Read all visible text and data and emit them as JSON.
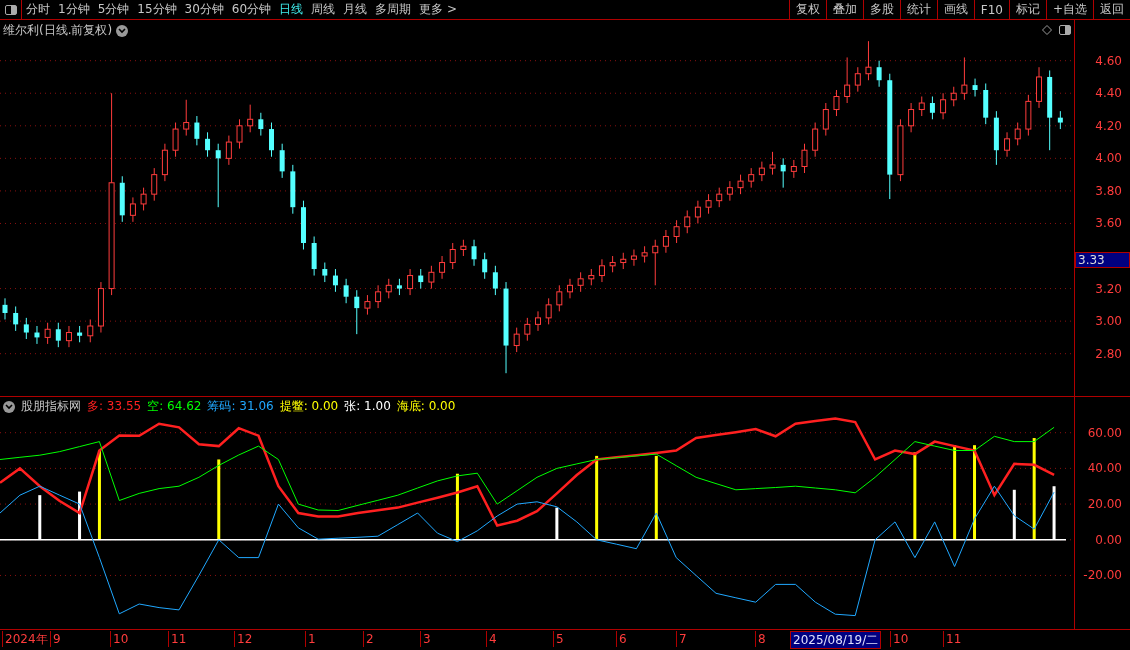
{
  "toolbar": {
    "periods": [
      {
        "label": "分时",
        "selected": false
      },
      {
        "label": "1分钟",
        "selected": false
      },
      {
        "label": "5分钟",
        "selected": false
      },
      {
        "label": "15分钟",
        "selected": false
      },
      {
        "label": "30分钟",
        "selected": false
      },
      {
        "label": "60分钟",
        "selected": false
      },
      {
        "label": "日线",
        "selected": true
      },
      {
        "label": "周线",
        "selected": false
      },
      {
        "label": "月线",
        "selected": false
      },
      {
        "label": "多周期",
        "selected": false
      },
      {
        "label": "更多 >",
        "selected": false
      }
    ],
    "actions": [
      "复权",
      "叠加",
      "多股",
      "统计",
      "画线",
      "F10",
      "标记",
      "+自选",
      "返回"
    ]
  },
  "main_chart": {
    "title": "维尔利(日线.前复权)",
    "current_price": "3.33",
    "chart_data": {
      "type": "candlestick",
      "grid": true,
      "ylim": [
        2.54,
        4.85
      ],
      "yticks": [
        {
          "value": 4.6,
          "label": "4.60"
        },
        {
          "value": 4.4,
          "label": "4.40"
        },
        {
          "value": 4.2,
          "label": "4.20"
        },
        {
          "value": 4.0,
          "label": "4.00"
        },
        {
          "value": 3.8,
          "label": "3.80"
        },
        {
          "value": 3.6,
          "label": "3.60"
        },
        {
          "value": 3.2,
          "label": "3.20"
        },
        {
          "value": 3.0,
          "label": "3.00"
        },
        {
          "value": 2.8,
          "label": "2.80"
        }
      ],
      "categories": [
        null,
        null,
        null,
        null,
        null,
        null,
        null,
        null,
        null,
        null,
        null,
        null,
        null,
        null,
        null,
        null,
        null,
        null,
        null,
        null,
        null,
        null,
        null,
        null,
        null,
        null,
        null,
        null,
        null,
        null,
        null,
        null,
        null,
        null,
        null,
        null,
        null,
        null,
        null,
        null,
        null,
        null,
        null,
        null,
        null,
        null,
        null,
        null,
        null,
        null,
        null,
        null,
        null,
        null,
        null,
        null,
        null,
        null,
        null,
        null,
        null,
        null,
        null,
        null,
        null,
        null,
        null,
        null,
        null,
        null,
        null,
        null,
        null,
        null,
        null,
        null,
        null,
        null,
        null,
        null,
        null,
        null,
        null,
        null,
        null,
        null,
        null,
        null,
        null,
        null,
        null,
        null,
        null,
        null,
        null,
        null,
        null,
        null,
        null,
        null
      ],
      "ohlc": [
        [
          3.1,
          3.14,
          3.01,
          3.05
        ],
        [
          3.05,
          3.09,
          2.94,
          2.98
        ],
        [
          2.98,
          3.02,
          2.89,
          2.93
        ],
        [
          2.93,
          2.97,
          2.86,
          2.9
        ],
        [
          2.9,
          2.99,
          2.86,
          2.95
        ],
        [
          2.95,
          2.99,
          2.84,
          2.88
        ],
        [
          2.88,
          2.97,
          2.84,
          2.93
        ],
        [
          2.93,
          2.97,
          2.87,
          2.91
        ],
        [
          2.91,
          3.01,
          2.87,
          2.97
        ],
        [
          2.97,
          3.24,
          2.93,
          3.2
        ],
        [
          3.2,
          4.4,
          3.16,
          3.85
        ],
        [
          3.85,
          3.89,
          3.61,
          3.65
        ],
        [
          3.65,
          3.76,
          3.61,
          3.72
        ],
        [
          3.72,
          3.82,
          3.68,
          3.78
        ],
        [
          3.78,
          3.94,
          3.74,
          3.9
        ],
        [
          3.9,
          4.09,
          3.86,
          4.05
        ],
        [
          4.05,
          4.22,
          4.01,
          4.18
        ],
        [
          4.18,
          4.36,
          4.14,
          4.22
        ],
        [
          4.22,
          4.26,
          4.08,
          4.12
        ],
        [
          4.12,
          4.16,
          4.01,
          4.05
        ],
        [
          4.05,
          4.09,
          3.7,
          4.0
        ],
        [
          4.0,
          4.14,
          3.96,
          4.1
        ],
        [
          4.1,
          4.24,
          4.06,
          4.2
        ],
        [
          4.2,
          4.33,
          4.16,
          4.24
        ],
        [
          4.24,
          4.28,
          4.14,
          4.18
        ],
        [
          4.18,
          4.22,
          4.01,
          4.05
        ],
        [
          4.05,
          4.09,
          3.88,
          3.92
        ],
        [
          3.92,
          3.96,
          3.66,
          3.7
        ],
        [
          3.7,
          3.74,
          3.44,
          3.48
        ],
        [
          3.48,
          3.52,
          3.28,
          3.32
        ],
        [
          3.32,
          3.36,
          3.24,
          3.28
        ],
        [
          3.28,
          3.32,
          3.18,
          3.22
        ],
        [
          3.22,
          3.26,
          3.11,
          3.15
        ],
        [
          3.15,
          3.19,
          2.92,
          3.08
        ],
        [
          3.08,
          3.16,
          3.04,
          3.12
        ],
        [
          3.12,
          3.22,
          3.08,
          3.18
        ],
        [
          3.18,
          3.26,
          3.14,
          3.22
        ],
        [
          3.22,
          3.26,
          3.16,
          3.2
        ],
        [
          3.2,
          3.32,
          3.16,
          3.28
        ],
        [
          3.28,
          3.32,
          3.2,
          3.24
        ],
        [
          3.24,
          3.34,
          3.2,
          3.3
        ],
        [
          3.3,
          3.4,
          3.26,
          3.36
        ],
        [
          3.36,
          3.48,
          3.32,
          3.44
        ],
        [
          3.44,
          3.5,
          3.4,
          3.46
        ],
        [
          3.46,
          3.5,
          3.34,
          3.38
        ],
        [
          3.38,
          3.42,
          3.26,
          3.3
        ],
        [
          3.3,
          3.34,
          3.16,
          3.2
        ],
        [
          3.2,
          3.24,
          2.68,
          2.85
        ],
        [
          2.85,
          2.96,
          2.81,
          2.92
        ],
        [
          2.92,
          3.02,
          2.88,
          2.98
        ],
        [
          2.98,
          3.06,
          2.94,
          3.02
        ],
        [
          3.02,
          3.14,
          2.98,
          3.1
        ],
        [
          3.1,
          3.22,
          3.06,
          3.18
        ],
        [
          3.18,
          3.26,
          3.14,
          3.22
        ],
        [
          3.22,
          3.3,
          3.18,
          3.26
        ],
        [
          3.26,
          3.32,
          3.22,
          3.28
        ],
        [
          3.28,
          3.38,
          3.24,
          3.34
        ],
        [
          3.34,
          3.4,
          3.3,
          3.36
        ],
        [
          3.36,
          3.42,
          3.32,
          3.38
        ],
        [
          3.38,
          3.44,
          3.34,
          3.4
        ],
        [
          3.4,
          3.46,
          3.36,
          3.42
        ],
        [
          3.42,
          3.5,
          3.22,
          3.46
        ],
        [
          3.46,
          3.56,
          3.42,
          3.52
        ],
        [
          3.52,
          3.62,
          3.48,
          3.58
        ],
        [
          3.58,
          3.68,
          3.54,
          3.64
        ],
        [
          3.64,
          3.74,
          3.6,
          3.7
        ],
        [
          3.7,
          3.78,
          3.66,
          3.74
        ],
        [
          3.74,
          3.82,
          3.7,
          3.78
        ],
        [
          3.78,
          3.86,
          3.74,
          3.82
        ],
        [
          3.82,
          3.9,
          3.78,
          3.86
        ],
        [
          3.86,
          3.94,
          3.82,
          3.9
        ],
        [
          3.9,
          3.98,
          3.86,
          3.94
        ],
        [
          3.94,
          4.04,
          3.9,
          3.96
        ],
        [
          3.96,
          4.0,
          3.82,
          3.92
        ],
        [
          3.92,
          3.99,
          3.88,
          3.95
        ],
        [
          3.95,
          4.09,
          3.91,
          4.05
        ],
        [
          4.05,
          4.22,
          4.01,
          4.18
        ],
        [
          4.18,
          4.34,
          4.14,
          4.3
        ],
        [
          4.3,
          4.42,
          4.26,
          4.38
        ],
        [
          4.38,
          4.62,
          4.34,
          4.45
        ],
        [
          4.45,
          4.56,
          4.41,
          4.52
        ],
        [
          4.52,
          4.72,
          4.48,
          4.56
        ],
        [
          4.56,
          4.6,
          4.44,
          4.48
        ],
        [
          4.48,
          4.52,
          3.75,
          3.9
        ],
        [
          3.9,
          4.24,
          3.86,
          4.2
        ],
        [
          4.2,
          4.34,
          4.16,
          4.3
        ],
        [
          4.3,
          4.38,
          4.26,
          4.34
        ],
        [
          4.34,
          4.38,
          4.24,
          4.28
        ],
        [
          4.28,
          4.4,
          4.24,
          4.36
        ],
        [
          4.36,
          4.44,
          4.32,
          4.4
        ],
        [
          4.4,
          4.62,
          4.36,
          4.45
        ],
        [
          4.45,
          4.49,
          4.38,
          4.42
        ],
        [
          4.42,
          4.46,
          4.21,
          4.25
        ],
        [
          4.25,
          4.29,
          3.96,
          4.05
        ],
        [
          4.05,
          4.16,
          4.01,
          4.12
        ],
        [
          4.12,
          4.22,
          4.08,
          4.18
        ],
        [
          4.18,
          4.39,
          4.14,
          4.35
        ],
        [
          4.35,
          4.56,
          4.31,
          4.5
        ],
        [
          4.5,
          4.54,
          4.05,
          4.25
        ],
        [
          4.25,
          4.29,
          4.18,
          4.22
        ]
      ]
    }
  },
  "indicator": {
    "name": "股朋指标网",
    "legend": [
      {
        "value": ": 33.55",
        "color": "#ff2020"
      },
      {
        "value": ": 64.62",
        "color": "#00ff00"
      },
      {
        "value": ": 31.06",
        "color": "#20a8ff"
      },
      {
        "value": ": 0.00",
        "color": "#ffff00"
      },
      {
        "value": ": 1.00",
        "color": "#ffffff"
      },
      {
        "label": "海底",
        "value": ": 0.00",
        "color": "#ffff00"
      }
    ],
    "chart_data": {
      "type": "line",
      "categories": [
        null,
        null,
        null,
        null,
        null,
        null,
        null,
        null,
        null,
        null,
        null,
        null,
        null,
        null,
        null,
        null,
        null,
        null,
        null,
        null,
        null,
        null,
        null,
        null,
        null,
        null,
        null,
        null,
        null,
        null,
        null,
        null,
        null,
        null,
        null,
        null,
        null,
        null,
        null,
        null,
        null,
        null,
        null,
        null,
        null,
        null,
        null,
        null,
        null,
        null,
        null,
        null,
        null,
        null
      ],
      "ylim": [
        -50,
        80
      ],
      "grid": true,
      "yticks": [
        {
          "value": 60,
          "label": "60.00"
        },
        {
          "value": 40,
          "label": "40.00"
        },
        {
          "value": 20,
          "label": "20.00"
        },
        {
          "value": 0,
          "label": "0.00"
        },
        {
          "value": -20,
          "label": "-20.00"
        }
      ],
      "series": [
        {
          "name": "多",
          "color": "#ff2020",
          "values": [
            32,
            40,
            30,
            21.7,
            15,
            50,
            58.5,
            58.3,
            65,
            63,
            53.5,
            52.5,
            62.5,
            58.3,
            30,
            15,
            13,
            13,
            15,
            16.5,
            18,
            20.8,
            23.6,
            26.5,
            30,
            8,
            10.7,
            16,
            26,
            36.3,
            45,
            46.2,
            47.4,
            48.7,
            50,
            57,
            58.7,
            60.3,
            62,
            58,
            65,
            66.5,
            68,
            66,
            45,
            50,
            48,
            55,
            52.5,
            50,
            25,
            42.5,
            42,
            36.4
          ]
        },
        {
          "name": "空",
          "color": "#00ff00",
          "values": [
            45,
            46.2,
            47.4,
            49.4,
            52.2,
            55,
            22,
            26,
            28.7,
            30,
            35,
            41.7,
            47.5,
            52.5,
            45,
            20,
            16.7,
            16.4,
            19.3,
            22.1,
            25,
            29,
            33,
            35.8,
            37.3,
            20,
            27.5,
            35,
            40,
            42.5,
            45,
            46,
            47,
            48,
            41.5,
            35,
            31.5,
            28,
            28.7,
            29.3,
            30,
            29,
            28,
            26.3,
            35,
            45,
            55,
            52.5,
            50,
            50,
            58,
            55,
            55,
            63
          ]
        },
        {
          "name": "筹码",
          "color": "#20a8ff",
          "values": [
            15,
            25,
            30,
            25,
            20,
            -10,
            -41.5,
            -36,
            -38,
            -39.3,
            -20,
            0,
            -10,
            -10,
            20,
            6.7,
            0.3,
            0.9,
            1.4,
            2,
            8.5,
            15,
            3.7,
            -1,
            5,
            13.3,
            20,
            21.3,
            18.5,
            10,
            0,
            -2.5,
            -5,
            15,
            -10,
            -20,
            -30,
            -32.5,
            -35,
            -25,
            -25,
            -35,
            -41.7,
            -42.5,
            0,
            10,
            -10,
            10,
            -15,
            11.7,
            30,
            13.5,
            6,
            26.7
          ]
        },
        {
          "name": "提鳖",
          "type": "bar",
          "color": "#ffff00",
          "values": [
            null,
            null,
            null,
            null,
            null,
            50,
            null,
            null,
            null,
            null,
            null,
            45,
            null,
            null,
            null,
            null,
            null,
            null,
            null,
            null,
            null,
            null,
            null,
            37,
            null,
            null,
            null,
            null,
            null,
            null,
            47,
            null,
            null,
            47,
            null,
            null,
            null,
            null,
            null,
            null,
            null,
            null,
            null,
            null,
            null,
            null,
            49,
            null,
            53,
            53,
            null,
            null,
            57,
            null
          ]
        },
        {
          "name": "张",
          "type": "bar",
          "color": "#ffffff",
          "values": [
            null,
            null,
            25,
            null,
            27,
            null,
            null,
            null,
            null,
            null,
            null,
            null,
            null,
            null,
            null,
            null,
            null,
            null,
            null,
            null,
            null,
            null,
            null,
            null,
            null,
            null,
            null,
            null,
            18,
            null,
            null,
            null,
            null,
            null,
            null,
            null,
            null,
            null,
            null,
            null,
            null,
            null,
            null,
            null,
            null,
            null,
            null,
            null,
            null,
            null,
            null,
            28,
            null,
            30
          ]
        }
      ]
    }
  },
  "time_axis": {
    "labels": [
      {
        "text": "2024年",
        "selected": false
      },
      {
        "text": "9",
        "selected": false
      },
      {
        "text": "10",
        "selected": false
      },
      {
        "text": "11",
        "selected": false
      },
      {
        "text": "12",
        "selected": false
      },
      {
        "text": "1",
        "selected": false
      },
      {
        "text": "2",
        "selected": false
      },
      {
        "text": "3",
        "selected": false
      },
      {
        "text": "4",
        "selected": false
      },
      {
        "text": "5",
        "selected": false
      },
      {
        "text": "6",
        "selected": false
      },
      {
        "text": "7",
        "selected": false
      },
      {
        "text": "8",
        "selected": false
      },
      {
        "text": "2025/08/19/二",
        "selected": true
      },
      {
        "text": "10",
        "selected": false
      },
      {
        "text": "11",
        "selected": false
      }
    ]
  }
}
